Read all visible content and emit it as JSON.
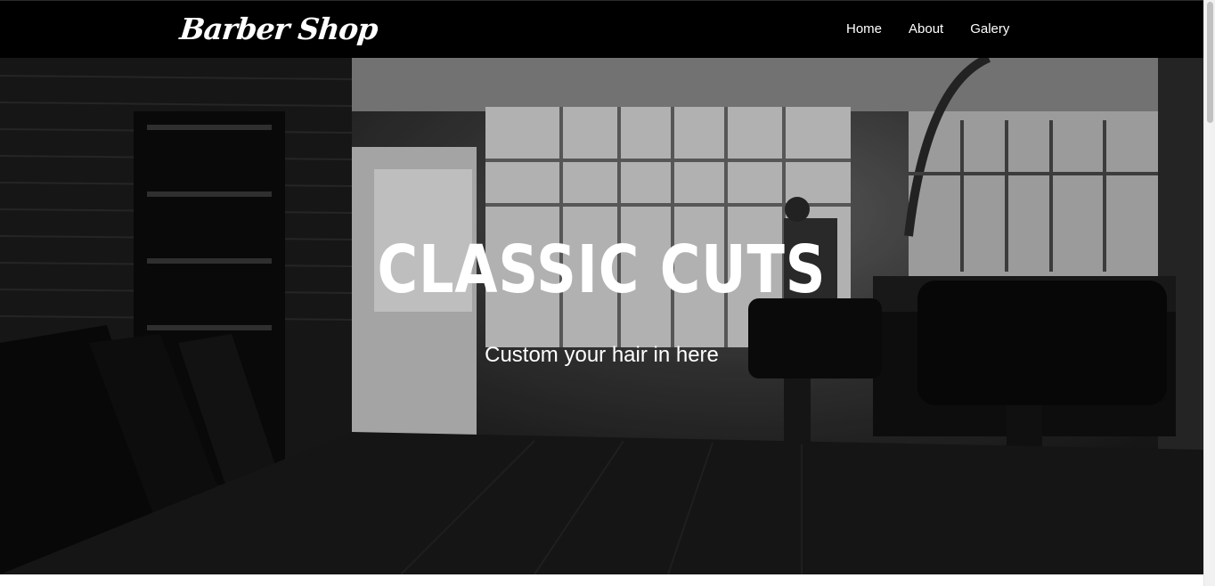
{
  "navbar": {
    "brand": "Barber Shop",
    "links": [
      {
        "label": "Home"
      },
      {
        "label": "About"
      },
      {
        "label": "Galery"
      }
    ]
  },
  "hero": {
    "title": "CLASSIC CUTS",
    "subtitle": "Custom your hair in here",
    "image_tone": "black-and-white barbershop interior"
  },
  "colors": {
    "navbar_bg": "#000000",
    "text": "#ffffff",
    "scrollbar_track": "#f1f1f1",
    "scrollbar_thumb": "#c1c1c1"
  }
}
